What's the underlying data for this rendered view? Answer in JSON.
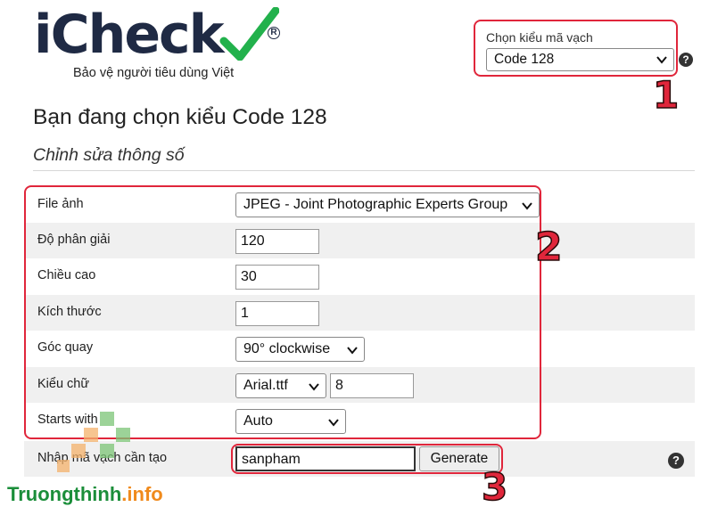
{
  "logo": {
    "word": "iCheck",
    "tagline": "Bảo vệ người tiêu dùng Việt"
  },
  "barcode_type": {
    "label": "Chọn kiểu mã vạch",
    "selected": "Code 128",
    "help": "?"
  },
  "annotations": {
    "one": "1",
    "two": "2",
    "three": "3"
  },
  "heading": "Bạn đang chọn kiểu Code 128",
  "subheading": "Chỉnh sửa thông số",
  "params": {
    "file": {
      "label": "File ảnh",
      "value": "JPEG - Joint Photographic Experts Group"
    },
    "resolution": {
      "label": "Độ phân giải",
      "value": "120"
    },
    "height": {
      "label": "Chiều cao",
      "value": "30"
    },
    "size": {
      "label": "Kích thước",
      "value": "1"
    },
    "rotation": {
      "label": "Góc quay",
      "value": "90° clockwise"
    },
    "font": {
      "label": "Kiểu chữ",
      "value": "Arial.ttf",
      "size": "8"
    },
    "starts_with": {
      "label": "Starts with",
      "value": "Auto"
    }
  },
  "generate": {
    "label": "Nhập mã vạch cần tạo",
    "input_value": "sanpham",
    "button": "Generate",
    "help": "?"
  },
  "watermark": {
    "part1": "Truongthinh",
    "part2": ".info"
  },
  "colors": {
    "annotation_red": "#e0263b",
    "logo_navy": "#1f2a44",
    "logo_green": "#22b14c",
    "row_shade": "#f0f0f0"
  }
}
